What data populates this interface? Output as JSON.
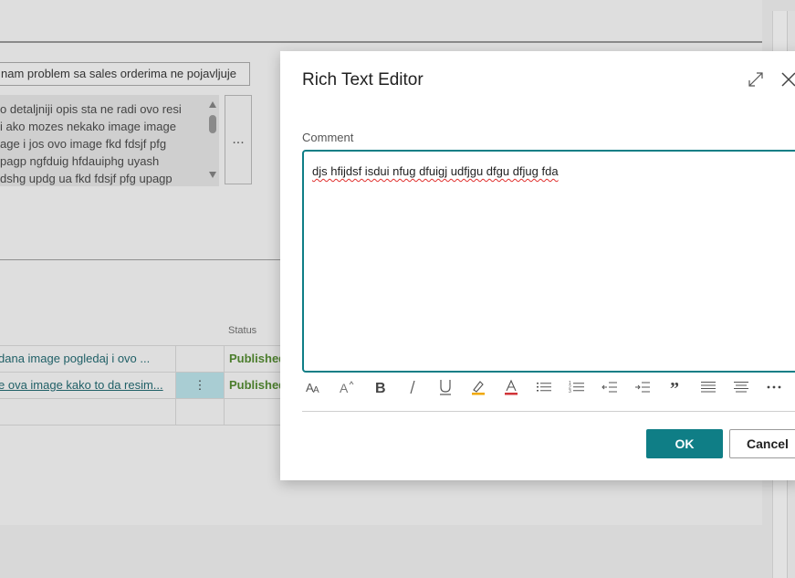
{
  "background": {
    "subject_text": "nam problem sa sales orderima ne pojavljuje",
    "description_lines": [
      "o detaljniji opis sta ne radi ovo resi",
      "i ako mozes nekako image image",
      "age i jos ovo image fkd fdsjf pfg",
      "pagp ngfduig hfdauiphg uyash",
      "dshg updg ua fkd fdsjf pfg upagp"
    ],
    "assist_button": "...",
    "status_header": "Status",
    "rows": [
      {
        "text": "dana  image  pogledaj i ovo ...",
        "menu": "",
        "status": "Published"
      },
      {
        "text": "e ova image kako to da resim...",
        "menu": "⋮",
        "status": "Published"
      },
      {
        "text": "",
        "menu": "",
        "status": ""
      }
    ]
  },
  "dialog": {
    "title": "Rich Text Editor",
    "field_label": "Comment",
    "content": "djs hfijdsf isdui nfug dfuigj udfjgu dfgu dfjug fda",
    "ok_label": "OK",
    "cancel_label": "Cancel"
  },
  "colors": {
    "accent": "#0f7e86",
    "status_published": "#4b7d2c",
    "spellcheck": "#e0302e"
  },
  "toolbar_icons": [
    "font-size-icon",
    "grow-font-icon",
    "bold-icon",
    "italic-icon",
    "underline-icon",
    "highlight-icon",
    "font-color-icon",
    "bulleted-list-icon",
    "numbered-list-icon",
    "decrease-indent-icon",
    "increase-indent-icon",
    "quote-icon",
    "align-left-icon",
    "align-center-icon",
    "more-options-icon"
  ]
}
